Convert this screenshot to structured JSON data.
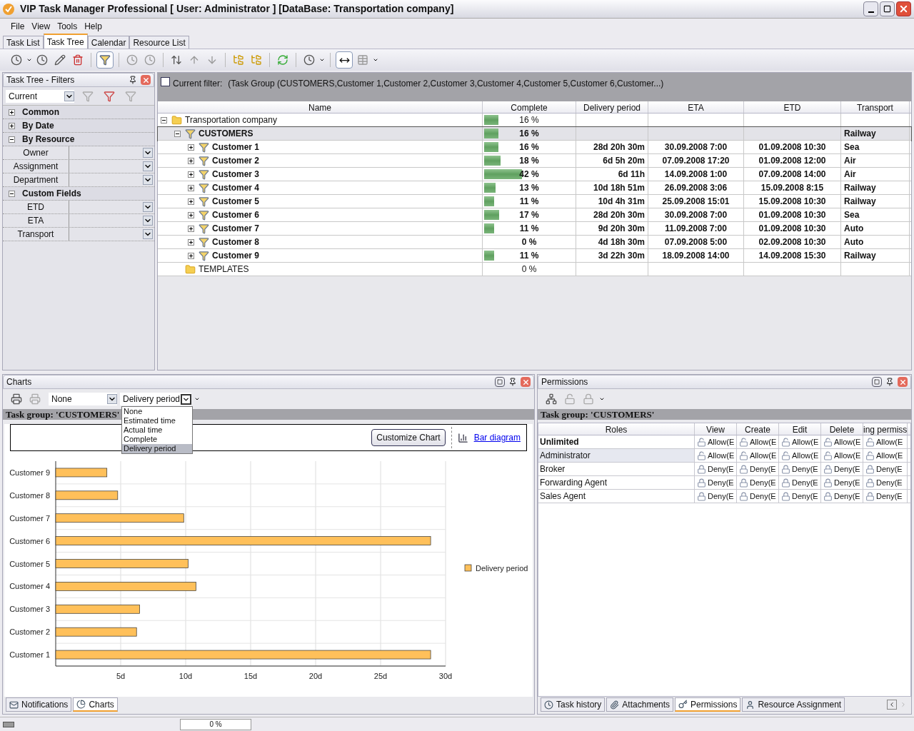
{
  "window": {
    "title": "VIP Task Manager Professional [ User: Administrator ] [DataBase: Transportation company]"
  },
  "menu": [
    "File",
    "View",
    "Tools",
    "Help"
  ],
  "tabs": [
    {
      "label": "Task List",
      "selected": false
    },
    {
      "label": "Task Tree",
      "selected": true
    },
    {
      "label": "Calendar",
      "selected": false
    },
    {
      "label": "Resource List",
      "selected": false
    }
  ],
  "filters_panel": {
    "title": "Task Tree - Filters",
    "preset": "Current",
    "groups": [
      {
        "label": "Common",
        "expanded": false
      },
      {
        "label": "By Date",
        "expanded": false
      },
      {
        "label": "By Resource",
        "expanded": true,
        "fields": [
          "Owner",
          "Assignment",
          "Department"
        ]
      },
      {
        "label": "Custom Fields",
        "expanded": true,
        "fields": [
          "ETD",
          "ETA",
          "Transport"
        ]
      }
    ]
  },
  "filter_bar": {
    "checked": false,
    "label": "Current filter:",
    "text": "(Task Group  (CUSTOMERS,Customer 1,Customer 2,Customer 3,Customer 4,Customer 5,Customer 6,Customer...)"
  },
  "tree": {
    "columns": [
      "Name",
      "Complete",
      "Delivery period",
      "ETA",
      "ETD",
      "Transport"
    ],
    "rows": [
      {
        "kind": "project",
        "name": "Transportation company",
        "complete": "16 %",
        "level": 0.16,
        "expanded": true,
        "selected": false,
        "children": [
          {
            "kind": "filter",
            "name": "CUSTOMERS",
            "complete": "16 %",
            "level": 0.16,
            "transport": "Railway",
            "expanded": true,
            "selected": true,
            "children": [
              {
                "kind": "filter",
                "name": "Customer 1",
                "complete": "16 %",
                "level": 0.16,
                "delivery": "28d 20h 30m",
                "eta": "30.09.2008 7:00",
                "etd": "01.09.2008 10:30",
                "transport": "Sea",
                "expanded": false,
                "selected": false
              },
              {
                "kind": "filter",
                "name": "Customer 2",
                "complete": "18 %",
                "level": 0.18,
                "delivery": "6d 5h 20m",
                "eta": "07.09.2008 17:20",
                "etd": "01.09.2008 12:00",
                "transport": "Air",
                "expanded": false,
                "selected": false
              },
              {
                "kind": "filter",
                "name": "Customer 3",
                "complete": "42 %",
                "level": 0.42,
                "delivery": "6d 11h",
                "eta": "14.09.2008 1:00",
                "etd": "07.09.2008 14:00",
                "transport": "Air",
                "expanded": false,
                "selected": false
              },
              {
                "kind": "filter",
                "name": "Customer 4",
                "complete": "13 %",
                "level": 0.13,
                "delivery": "10d 18h 51m",
                "eta": "26.09.2008 3:06",
                "etd": "15.09.2008 8:15",
                "transport": "Railway",
                "expanded": false,
                "selected": false
              },
              {
                "kind": "filter",
                "name": "Customer 5",
                "complete": "11 %",
                "level": 0.11,
                "delivery": "10d 4h 31m",
                "eta": "25.09.2008 15:01",
                "etd": "15.09.2008 10:30",
                "transport": "Railway",
                "expanded": false,
                "selected": false
              },
              {
                "kind": "filter",
                "name": "Customer 6",
                "complete": "17 %",
                "level": 0.17,
                "delivery": "28d 20h 30m",
                "eta": "30.09.2008 7:00",
                "etd": "01.09.2008 10:30",
                "transport": "Sea",
                "expanded": false,
                "selected": false
              },
              {
                "kind": "filter",
                "name": "Customer 7",
                "complete": "11 %",
                "level": 0.11,
                "delivery": "9d 20h 30m",
                "eta": "11.09.2008 7:00",
                "etd": "01.09.2008 10:30",
                "transport": "Auto",
                "expanded": false,
                "selected": false
              },
              {
                "kind": "filter",
                "name": "Customer 8",
                "complete": "0 %",
                "delivery": "4d 18h 30m",
                "eta": "07.09.2008 5:00",
                "etd": "02.09.2008 10:30",
                "transport": "Auto",
                "expanded": false,
                "selected": false
              },
              {
                "kind": "filter",
                "name": "Customer 9",
                "complete": "11 %",
                "level": 0.11,
                "delivery": "3d 22h 30m",
                "eta": "18.09.2008 14:00",
                "etd": "14.09.2008 15:30",
                "transport": "Railway",
                "expanded": false,
                "selected": false
              }
            ]
          },
          {
            "kind": "project",
            "name": "TEMPLATES",
            "complete": "0 %",
            "selected": false
          }
        ]
      }
    ]
  },
  "charts_panel": {
    "title": "Charts",
    "combo_1": "None",
    "combo_2": "Delivery period",
    "dropdown": [
      {
        "label": "None",
        "selected": false
      },
      {
        "label": "Estimated time",
        "selected": false
      },
      {
        "label": "Actual time",
        "selected": false
      },
      {
        "label": "Complete",
        "selected": false
      },
      {
        "label": "Delivery period",
        "selected": true
      }
    ],
    "header": "Task group: 'CUSTOMERS'",
    "customize_button": "Customize Chart",
    "link": "Bar diagram",
    "chart_data": {
      "type": "bar",
      "orientation": "horizontal",
      "grid": true,
      "categories": [
        "Customer 9",
        "Customer 8",
        "Customer 7",
        "Customer 6",
        "Customer 5",
        "Customer 4",
        "Customer 3",
        "Customer 2",
        "Customer 1"
      ],
      "series": [
        {
          "name": "Delivery period",
          "color": "#ffc05a",
          "values": [
            3.94,
            4.77,
            9.85,
            28.85,
            10.19,
            10.79,
            6.46,
            6.22,
            28.85
          ]
        }
      ],
      "xlim": [
        0,
        30
      ],
      "xticks": [
        {
          "value": 5,
          "label": "5d"
        },
        {
          "value": 10,
          "label": "10d"
        },
        {
          "value": 15,
          "label": "15d"
        },
        {
          "value": 20,
          "label": "20d"
        },
        {
          "value": 25,
          "label": "25d"
        },
        {
          "value": 30,
          "label": "30d"
        }
      ]
    },
    "tabs": [
      {
        "label": "Notifications",
        "selected": false
      },
      {
        "label": "Charts",
        "selected": true
      }
    ]
  },
  "permissions_panel": {
    "title": "Permissions",
    "header": "Task group: 'CUSTOMERS'",
    "role_column": "Roles",
    "permission_columns": [
      "View",
      "Create",
      "Edit",
      "Delete",
      "ing permiss"
    ],
    "rows": [
      {
        "role": "Unlimited",
        "emphasized": true,
        "selected": false,
        "cells": [
          {
            "kind": "allow",
            "text": "Allow(E"
          },
          {
            "kind": "allow",
            "text": "Allow(E"
          },
          {
            "kind": "allow",
            "text": "Allow(E"
          },
          {
            "kind": "allow",
            "text": "Allow(E"
          },
          {
            "kind": "allow",
            "text": "Allow(E"
          }
        ]
      },
      {
        "role": "Administrator",
        "emphasized": false,
        "selected": true,
        "cells": [
          {
            "kind": "allow",
            "text": "Allow(E"
          },
          {
            "kind": "allow",
            "text": "Allow(E"
          },
          {
            "kind": "allow",
            "text": "Allow(E"
          },
          {
            "kind": "allow",
            "text": "Allow(E"
          },
          {
            "kind": "allow",
            "text": "Allow(E"
          }
        ]
      },
      {
        "role": "Broker",
        "emphasized": false,
        "selected": false,
        "cells": [
          {
            "kind": "deny",
            "text": "Deny(E"
          },
          {
            "kind": "deny",
            "text": "Deny(E"
          },
          {
            "kind": "deny",
            "text": "Deny(E"
          },
          {
            "kind": "deny",
            "text": "Deny(E"
          },
          {
            "kind": "deny",
            "text": "Deny(E"
          }
        ]
      },
      {
        "role": "Forwarding Agent",
        "emphasized": false,
        "selected": false,
        "cells": [
          {
            "kind": "deny",
            "text": "Deny(E"
          },
          {
            "kind": "deny",
            "text": "Deny(E"
          },
          {
            "kind": "deny",
            "text": "Deny(E"
          },
          {
            "kind": "deny",
            "text": "Deny(E"
          },
          {
            "kind": "deny",
            "text": "Deny(E"
          }
        ]
      },
      {
        "role": "Sales Agent",
        "emphasized": false,
        "selected": false,
        "cells": [
          {
            "kind": "deny",
            "text": "Deny(E"
          },
          {
            "kind": "deny",
            "text": "Deny(E"
          },
          {
            "kind": "deny",
            "text": "Deny(E"
          },
          {
            "kind": "deny",
            "text": "Deny(E"
          },
          {
            "kind": "deny",
            "text": "Deny(E"
          }
        ]
      }
    ],
    "tabs": [
      {
        "label": "Task history",
        "selected": false
      },
      {
        "label": "Attachments",
        "selected": false
      },
      {
        "label": "Permissions",
        "selected": true
      },
      {
        "label": "Resource Assignment",
        "selected": false
      }
    ]
  },
  "status_bar": {
    "progress": "0 %"
  }
}
